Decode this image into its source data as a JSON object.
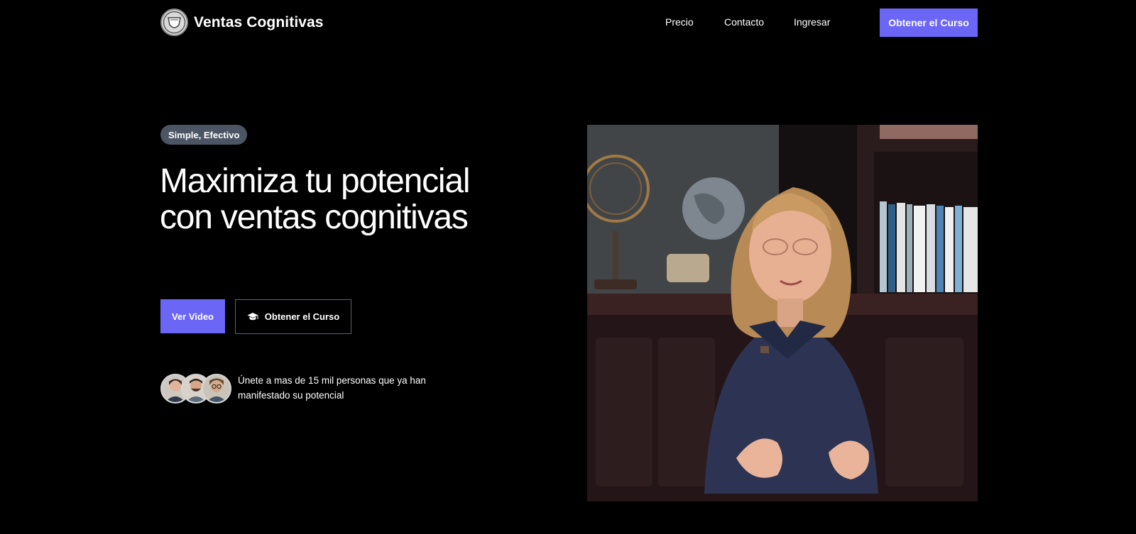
{
  "header": {
    "brand_name": "Ventas Cognitivas",
    "nav": [
      "Precio",
      "Contacto",
      "Ingresar"
    ],
    "cta_label": "Obtener el Curso"
  },
  "hero": {
    "badge": "Simple, Efectivo",
    "title": "Maximiza tu potencial con ventas cognitivas",
    "primary_button": "Ver Video",
    "secondary_button": "Obtener el Curso",
    "secondary_button_icon": "graduation-cap-icon",
    "social_proof": "Únete a mas de 15 mil personas que ya han manifestado su potencial"
  },
  "colors": {
    "background": "#000000",
    "accent": "#6b66f5",
    "badge": "#4b5563"
  }
}
